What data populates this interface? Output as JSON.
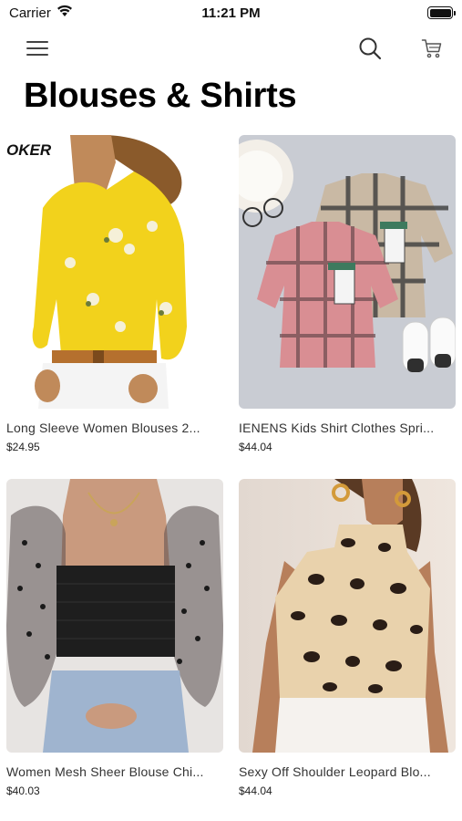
{
  "status_bar": {
    "carrier": "Carrier",
    "time": "11:21 PM",
    "battery_level": 1.0
  },
  "nav": {
    "menu_icon": "hamburger-icon",
    "search_icon": "search-icon",
    "cart_icon": "cart-icon"
  },
  "page": {
    "title": "Blouses & Shirts"
  },
  "products": [
    {
      "title": "Long Sleeve Women Blouses 2...",
      "price": "$24.95",
      "image_text": "OKER"
    },
    {
      "title": "IENENS Kids Shirt Clothes Spri...",
      "price": "$44.04"
    },
    {
      "title": "Women Mesh Sheer Blouse Chi...",
      "price": "$40.03"
    },
    {
      "title": "Sexy Off Shoulder Leopard Blo...",
      "price": "$44.04"
    }
  ],
  "colors": {
    "text_primary": "#000000",
    "text_secondary": "#333333",
    "icon": "#444444"
  }
}
